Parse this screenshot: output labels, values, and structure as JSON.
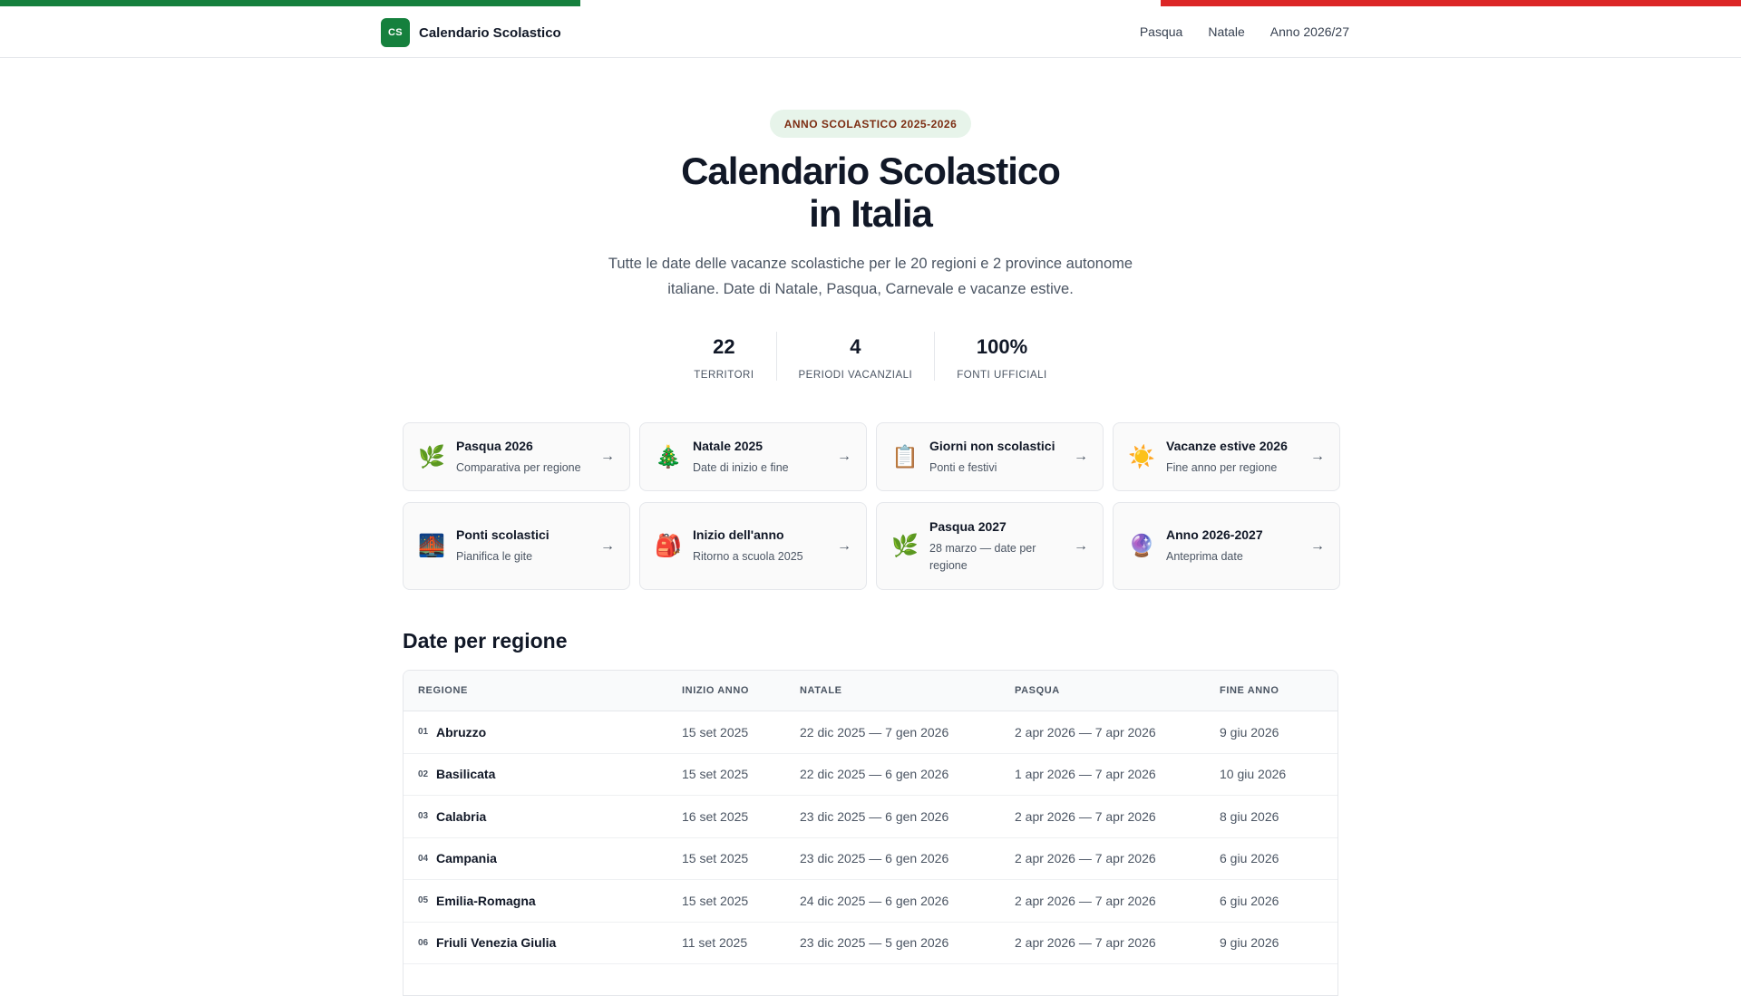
{
  "brand": {
    "logo": "CS",
    "name": "Calendario Scolastico"
  },
  "nav": [
    "Pasqua",
    "Natale",
    "Anno 2026/27"
  ],
  "hero": {
    "badge": "ANNO SCOLASTICO 2025-2026",
    "title_line1": "Calendario Scolastico",
    "title_line2": "in Italia",
    "subtitle": "Tutte le date delle vacanze scolastiche per le 20 regioni e 2 province autonome italiane. Date di Natale, Pasqua, Carnevale e vacanze estive."
  },
  "stats": [
    {
      "value": "22",
      "label": "TERRITORI"
    },
    {
      "value": "4",
      "label": "PERIODI VACANZIALI"
    },
    {
      "value": "100%",
      "label": "FONTI UFFICIALI"
    }
  ],
  "cards": [
    {
      "icon": "🌿",
      "icon_name": "leaf-icon",
      "title": "Pasqua 2026",
      "subtitle": "Comparativa per regione"
    },
    {
      "icon": "🎄",
      "icon_name": "christmas-tree-icon",
      "title": "Natale 2025",
      "subtitle": "Date di inizio e fine"
    },
    {
      "icon": "📋",
      "icon_name": "clipboard-icon",
      "title": "Giorni non scolastici",
      "subtitle": "Ponti e festivi"
    },
    {
      "icon": "☀️",
      "icon_name": "sun-icon",
      "title": "Vacanze estive 2026",
      "subtitle": "Fine anno per regione"
    },
    {
      "icon": "🌉",
      "icon_name": "bridge-icon",
      "title": "Ponti scolastici",
      "subtitle": "Pianifica le gite"
    },
    {
      "icon": "🎒",
      "icon_name": "backpack-icon",
      "title": "Inizio dell'anno",
      "subtitle": "Ritorno a scuola 2025"
    },
    {
      "icon": "🌿",
      "icon_name": "leaf-icon",
      "title": "Pasqua 2027",
      "subtitle": "28 marzo — date per regione"
    },
    {
      "icon": "🔮",
      "icon_name": "crystal-ball-icon",
      "title": "Anno 2026-2027",
      "subtitle": "Anteprima date"
    }
  ],
  "card_arrow": "→",
  "section_title": "Date per regione",
  "table": {
    "headers": [
      "REGIONE",
      "INIZIO ANNO",
      "NATALE",
      "PASQUA",
      "FINE ANNO"
    ],
    "rows": [
      {
        "n": "01",
        "regione": "Abruzzo",
        "inizio": "15 set 2025",
        "natale": "22 dic 2025 — 7 gen 2026",
        "pasqua": "2 apr 2026 — 7 apr 2026",
        "fine": "9 giu 2026"
      },
      {
        "n": "02",
        "regione": "Basilicata",
        "inizio": "15 set 2025",
        "natale": "22 dic 2025 — 6 gen 2026",
        "pasqua": "1 apr 2026 — 7 apr 2026",
        "fine": "10 giu 2026"
      },
      {
        "n": "03",
        "regione": "Calabria",
        "inizio": "16 set 2025",
        "natale": "23 dic 2025 — 6 gen 2026",
        "pasqua": "2 apr 2026 — 7 apr 2026",
        "fine": "8 giu 2026"
      },
      {
        "n": "04",
        "regione": "Campania",
        "inizio": "15 set 2025",
        "natale": "23 dic 2025 — 6 gen 2026",
        "pasqua": "2 apr 2026 — 7 apr 2026",
        "fine": "6 giu 2026"
      },
      {
        "n": "05",
        "regione": "Emilia-Romagna",
        "inizio": "15 set 2025",
        "natale": "24 dic 2025 — 6 gen 2026",
        "pasqua": "2 apr 2026 — 7 apr 2026",
        "fine": "6 giu 2026"
      },
      {
        "n": "06",
        "regione": "Friuli Venezia Giulia",
        "inizio": "11 set 2025",
        "natale": "23 dic 2025 — 5 gen 2026",
        "pasqua": "2 apr 2026 — 7 apr 2026",
        "fine": "9 giu 2026"
      }
    ]
  },
  "colors": {
    "green": "#15803d",
    "red": "#dc2626",
    "badge_bg": "#e7f4ea",
    "badge_text": "#7c2d12"
  }
}
